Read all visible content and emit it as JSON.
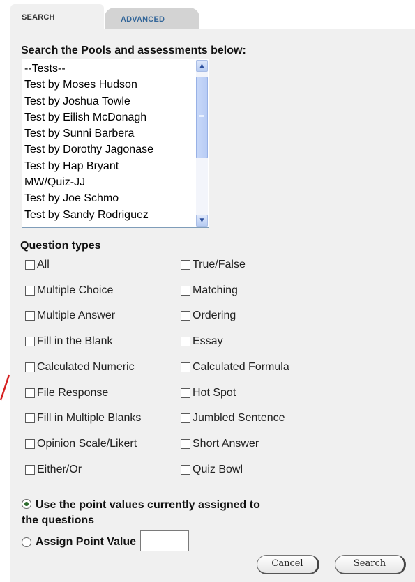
{
  "tabs": {
    "search_label": "SEARCH",
    "advanced_label": "ADVANCED"
  },
  "pool_section": {
    "heading": "Search the Pools and assessments below:",
    "options": [
      "--Tests--",
      "Test by Moses Hudson",
      "Test by Joshua Towle",
      "Test by Eilish McDonagh",
      "Test by Sunni Barbera",
      "Test by Dorothy Jagonase",
      "Test by Hap Bryant",
      "MW/Quiz-JJ",
      "Test by Joe Schmo",
      "Test by Sandy Rodriguez"
    ]
  },
  "question_types": {
    "heading": "Question types",
    "left": [
      {
        "label": "All",
        "checked": false
      },
      {
        "label": "Multiple Choice",
        "checked": false
      },
      {
        "label": "Multiple Answer",
        "checked": false
      },
      {
        "label": "Fill in the Blank",
        "checked": false
      },
      {
        "label": "Calculated Numeric",
        "checked": false
      },
      {
        "label": "File Response",
        "checked": false
      },
      {
        "label": "Fill in Multiple Blanks",
        "checked": false
      },
      {
        "label": "Opinion Scale/Likert",
        "checked": false
      },
      {
        "label": "Either/Or",
        "checked": false
      }
    ],
    "right": [
      {
        "label": "True/False",
        "checked": false
      },
      {
        "label": "Matching",
        "checked": false
      },
      {
        "label": "Ordering",
        "checked": false
      },
      {
        "label": "Essay",
        "checked": false
      },
      {
        "label": "Calculated Formula",
        "checked": false
      },
      {
        "label": "Hot Spot",
        "checked": false
      },
      {
        "label": "Jumbled Sentence",
        "checked": false
      },
      {
        "label": "Short Answer",
        "checked": false
      },
      {
        "label": "Quiz Bowl",
        "checked": false
      }
    ]
  },
  "points": {
    "use_current_label_line1": "Use the point values currently assigned to",
    "use_current_label_line2": "the questions",
    "use_current_selected": true,
    "assign_label": "Assign Point Value",
    "assign_selected": false,
    "assign_value": ""
  },
  "buttons": {
    "cancel_label": "Cancel",
    "search_label": "Search"
  },
  "colors": {
    "panel_bg": "#f0f0f0",
    "advanced_tab_text": "#336699",
    "annotation_arrow": "#d62020"
  }
}
